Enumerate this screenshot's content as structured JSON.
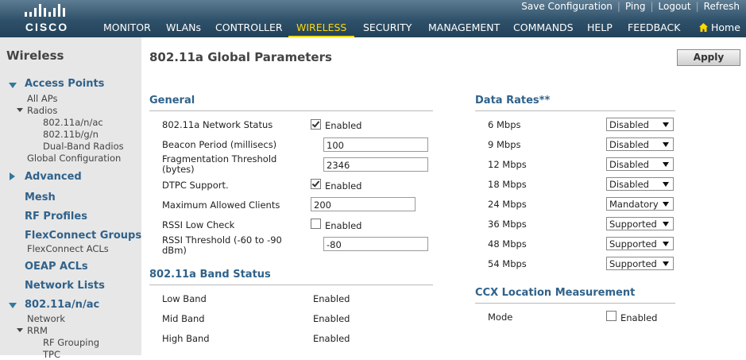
{
  "brand": {
    "logo_text": "CISCO"
  },
  "utility_links": [
    "Save Configuration",
    "Ping",
    "Logout",
    "Refresh"
  ],
  "nav": {
    "items": [
      "MONITOR",
      "WLANs",
      "CONTROLLER",
      "WIRELESS",
      "SECURITY",
      "MANAGEMENT",
      "COMMANDS",
      "HELP",
      "FEEDBACK"
    ],
    "active": "WIRELESS",
    "home_label": "Home"
  },
  "sidebar": {
    "title": "Wireless",
    "access_points": "Access Points",
    "all_aps": "All APs",
    "radios": "Radios",
    "radio_a": "802.11a/n/ac",
    "radio_b": "802.11b/g/n",
    "dual_band": "Dual-Band Radios",
    "global_config": "Global Configuration",
    "advanced": "Advanced",
    "mesh": "Mesh",
    "rf_profiles": "RF Profiles",
    "flexconnect_groups": "FlexConnect Groups",
    "flexconnect_acls": "FlexConnect ACLs",
    "oeap_acls": "OEAP ACLs",
    "network_lists": "Network Lists",
    "band": "802.11a/n/ac",
    "network": "Network",
    "rrm": "RRM",
    "rf_grouping": "RF Grouping",
    "tpc": "TPC"
  },
  "page": {
    "title": "802.11a Global Parameters",
    "apply": "Apply"
  },
  "general": {
    "title": "General",
    "network_status_label": "802.11a Network Status",
    "network_status_checked": true,
    "network_status_text": "Enabled",
    "beacon_label": "Beacon Period (millisecs)",
    "beacon_value": "100",
    "frag_label": "Fragmentation Threshold (bytes)",
    "frag_value": "2346",
    "dtpc_label": "DTPC Support.",
    "dtpc_checked": true,
    "dtpc_text": "Enabled",
    "max_clients_label": "Maximum Allowed Clients",
    "max_clients_value": "200",
    "rssi_check_label": "RSSI Low Check",
    "rssi_check_checked": false,
    "rssi_check_text": "Enabled",
    "rssi_threshold_label": "RSSI Threshold (-60 to -90 dBm)",
    "rssi_threshold_value": "-80"
  },
  "band_status": {
    "title": "802.11a Band Status",
    "rows": [
      {
        "label": "Low Band",
        "value": "Enabled"
      },
      {
        "label": "Mid Band",
        "value": "Enabled"
      },
      {
        "label": "High Band",
        "value": "Enabled"
      }
    ]
  },
  "data_rates": {
    "title": "Data Rates",
    "title_suffix": "**",
    "rows": [
      {
        "rate": "6 Mbps",
        "value": "Disabled"
      },
      {
        "rate": "9 Mbps",
        "value": "Disabled"
      },
      {
        "rate": "12 Mbps",
        "value": "Disabled"
      },
      {
        "rate": "18 Mbps",
        "value": "Disabled"
      },
      {
        "rate": "24 Mbps",
        "value": "Mandatory"
      },
      {
        "rate": "36 Mbps",
        "value": "Supported"
      },
      {
        "rate": "48 Mbps",
        "value": "Supported"
      },
      {
        "rate": "54 Mbps",
        "value": "Supported"
      }
    ]
  },
  "ccx": {
    "title": "CCX Location Measurement",
    "mode_label": "Mode",
    "mode_checked": false,
    "mode_text": "Enabled"
  },
  "colors": {
    "header_blue": "#2f5069",
    "nav_active": "#ffd800",
    "section_title": "#30628a",
    "sidebar_bg": "#e7e7e7"
  }
}
